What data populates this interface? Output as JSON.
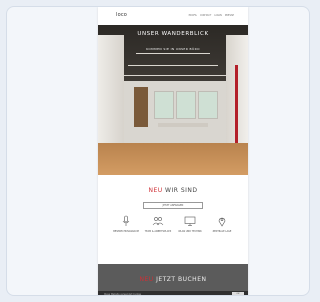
{
  "site": {
    "logo": "loco",
    "top_menu": [
      "PROFIL",
      "CONTACT",
      "LOGIN",
      "PRESSE"
    ]
  },
  "hero": {
    "title": "UNSER WANDERBLICK",
    "subtitle": "KOMMEN SIE IN UNSER BÜRO"
  },
  "section": {
    "title_accent": "NEU",
    "title_rest": " WIR SIND",
    "contact_button": "JETZT ANFRAGEN"
  },
  "features": [
    {
      "icon": "microphone-icon",
      "label": "BESPRECHUNGSRAUM"
    },
    {
      "icon": "people-icon",
      "label": "TEAM & ARBEITSPLATZ"
    },
    {
      "icon": "screen-icon",
      "label": "WLAN UND TECHNIK"
    },
    {
      "icon": "location-pin-icon",
      "label": "ZENTRALE LAGE"
    }
  ],
  "cta": {
    "title_accent": "NEU",
    "title_rest": " JETZT BUCHEN"
  },
  "cookie": {
    "text": "Diese Website verwendet Cookies",
    "button": "OK"
  },
  "colors": {
    "accent": "#cf2f35",
    "cta_bg": "#5b5b5b",
    "backdrop": "#e9eef5"
  }
}
